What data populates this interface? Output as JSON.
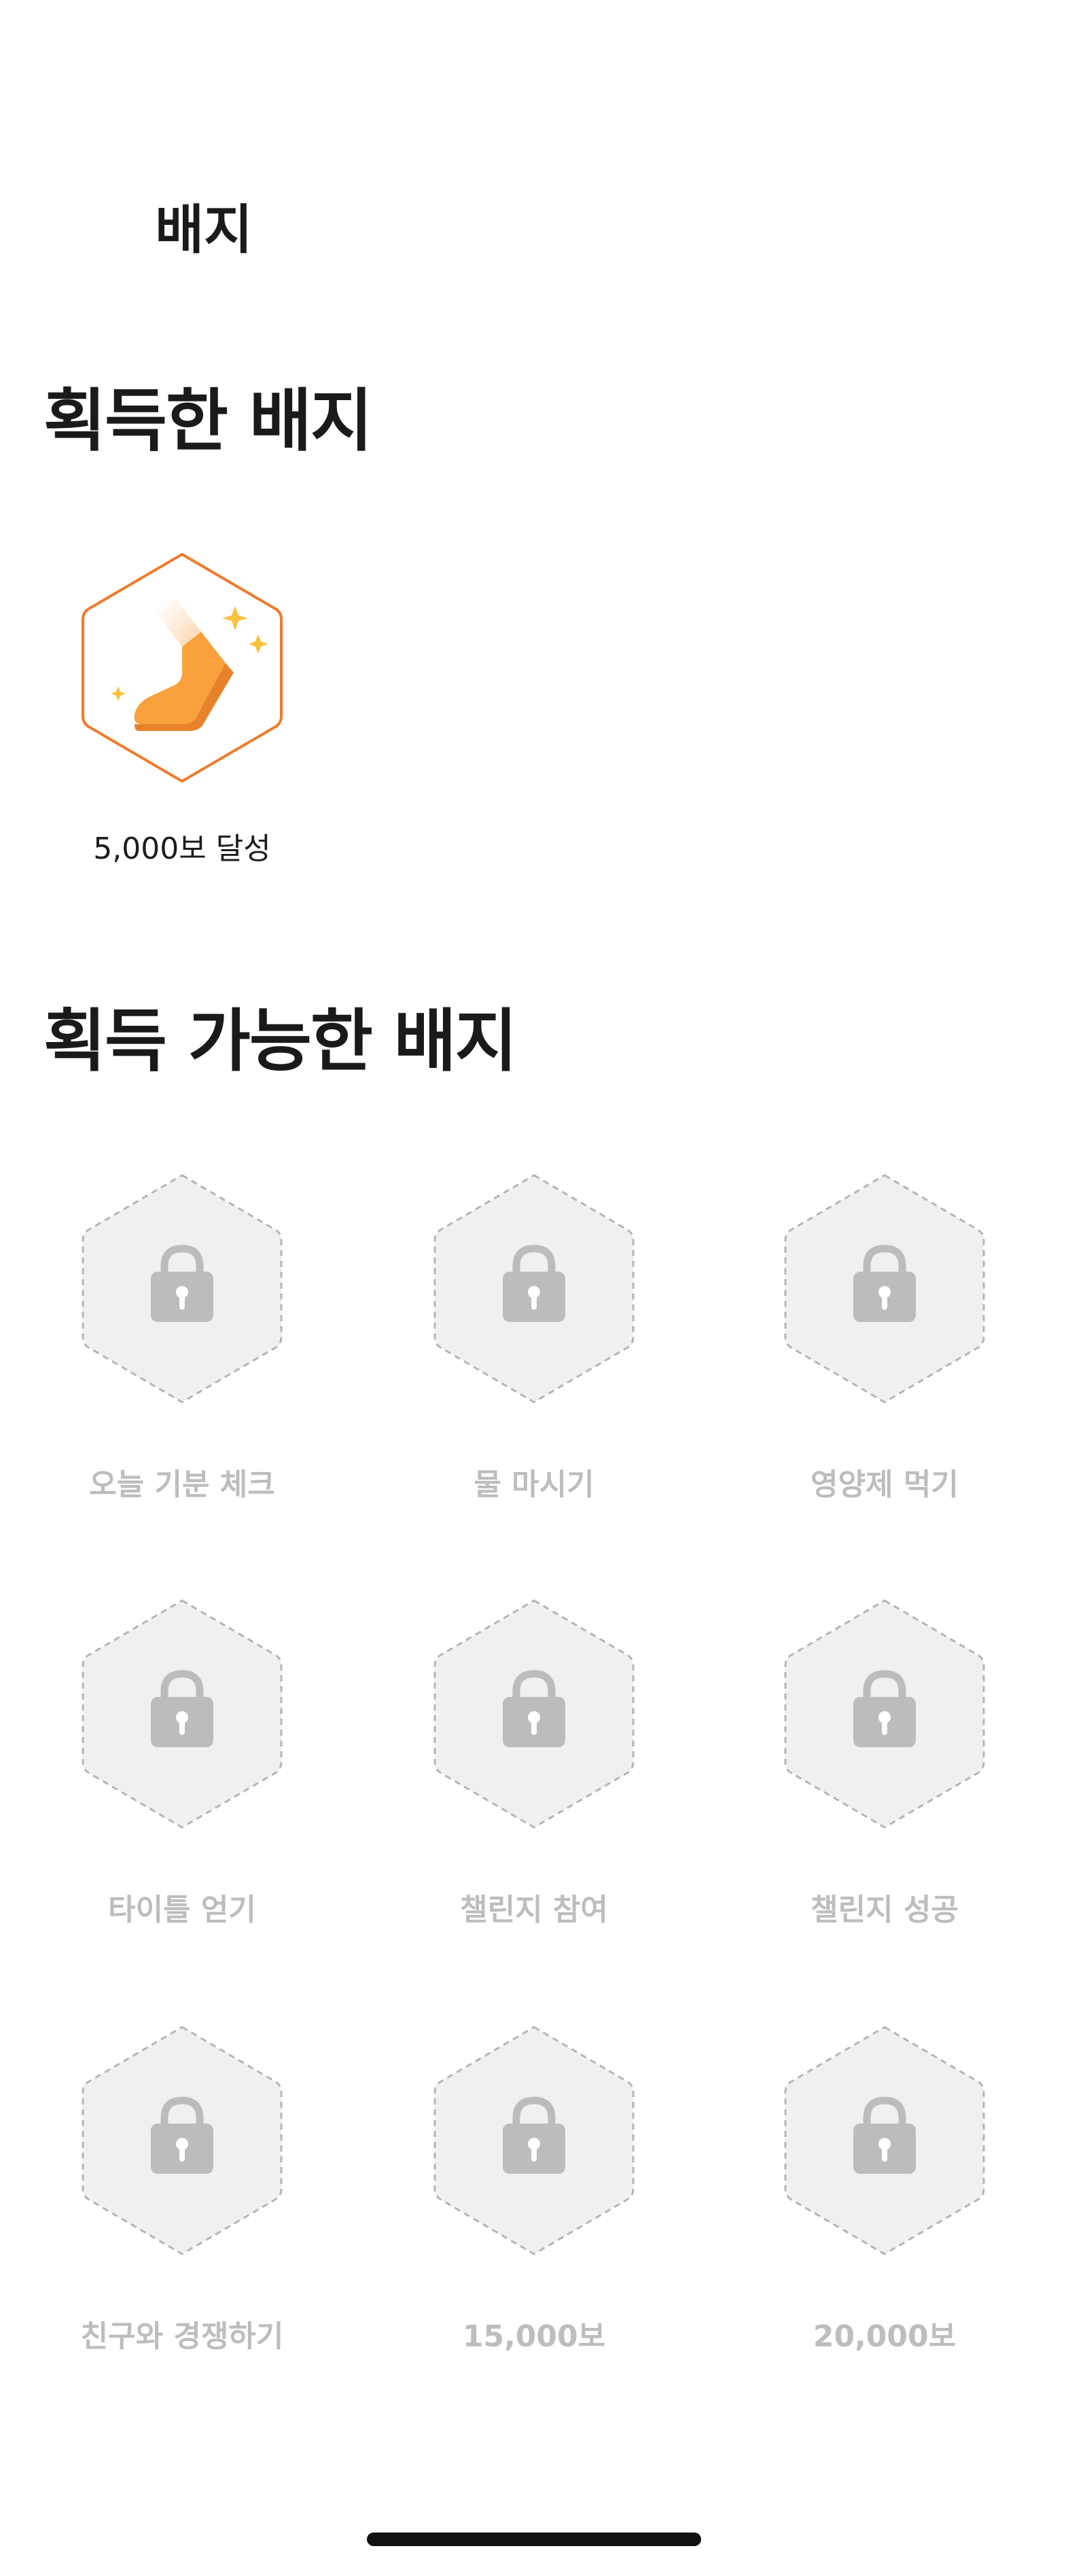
{
  "header": {
    "title": "배지"
  },
  "earned": {
    "title": "획득한 배지",
    "badges": [
      {
        "label": "5,000보 달성",
        "icon": "walking-shoe-icon"
      }
    ]
  },
  "available": {
    "title": "획득 가능한 배지",
    "badges": [
      {
        "label": "오늘 기분 체크",
        "icon": "lock-icon"
      },
      {
        "label": "물 마시기",
        "icon": "lock-icon"
      },
      {
        "label": "영양제 먹기",
        "icon": "lock-icon"
      },
      {
        "label": "타이틀 얻기",
        "icon": "lock-icon"
      },
      {
        "label": "챌린지 참여",
        "icon": "lock-icon"
      },
      {
        "label": "챌린지 성공",
        "icon": "lock-icon"
      },
      {
        "label": "친구와 경쟁하기",
        "icon": "lock-icon"
      },
      {
        "label": "15,000보",
        "icon": "lock-icon"
      },
      {
        "label": "20,000보",
        "icon": "lock-icon"
      }
    ]
  },
  "colors": {
    "accent": "#f07a2a",
    "shoe": "#f9a13c",
    "sparkle": "#f9c23c",
    "locked_fill": "#f0f0f0",
    "locked_stroke": "#b5b5b5",
    "lock": "#bcbcbc",
    "locked_text": "#bdbdbd"
  }
}
